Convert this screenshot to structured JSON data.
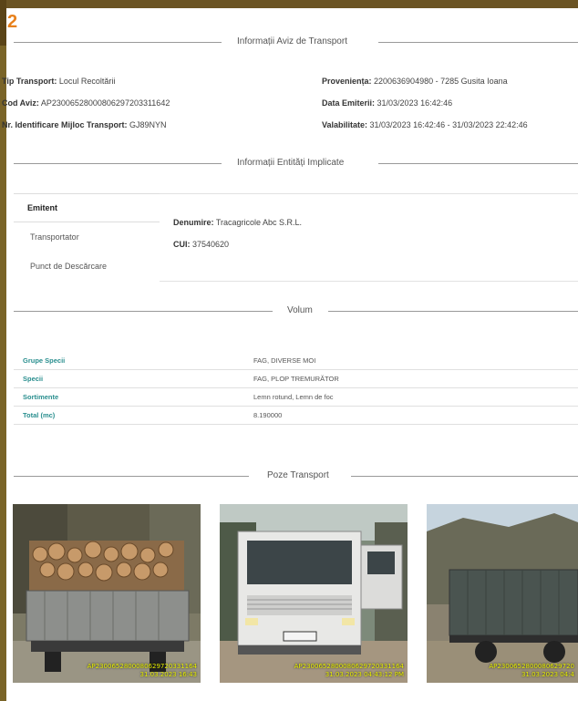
{
  "badge": "2",
  "sections": {
    "aviz": "Informații Aviz de Transport",
    "entitati": "Informații Entități Implicate",
    "volum": "Volum",
    "poze": "Poze Transport"
  },
  "aviz": {
    "tip_label": "Tip Transport:",
    "tip_value": " Locul Recoltării",
    "cod_label": "Cod Aviz:",
    "cod_value": " AP2300652800080629720331164​2",
    "nr_label": "Nr. Identificare Mijloc Transport:",
    "nr_value": " GJ89NYN",
    "prov_label": "Proveniența:",
    "prov_value": " 2200636904980 - 7285 Gusita Ioana",
    "data_label": "Data Emiterii:",
    "data_value": " 31/03/2023 16:42:46",
    "val_label": "Valabilitate:",
    "val_value": " 31/03/2023 16:42:46 - 31/03/2023 22:42:46"
  },
  "entitati": {
    "tabs": [
      "Emitent",
      "Transportator",
      "Punct de Descărcare"
    ],
    "denumire_label": "Denumire:",
    "denumire_value": " Tracagricole Abc S.R.L.",
    "cui_label": "CUI:",
    "cui_value": " 37540620"
  },
  "volum": {
    "rows": [
      {
        "k": "Grupe Specii",
        "v": "FAG, DIVERSE MOI"
      },
      {
        "k": "Specii",
        "v": "FAG, PLOP TREMURĂTOR"
      },
      {
        "k": "Sortimente",
        "v": "Lemn rotund, Lemn de foc"
      },
      {
        "k": "Total (mc)",
        "v": "8.190000"
      }
    ]
  },
  "photos": [
    {
      "stamp1": "AP2300652800080629720331164",
      "stamp2": "31.03.2023 16:43"
    },
    {
      "stamp1": "AP2300652800080629720331164",
      "stamp2": "31.03.2023 04:43:12 PM"
    },
    {
      "stamp1": "AP2300652800080629720",
      "stamp2": "31.03.2023 04:4"
    }
  ],
  "colors": {
    "accent": "#e8811c",
    "teal": "#2a8f8f",
    "frame": "#6b5424"
  }
}
